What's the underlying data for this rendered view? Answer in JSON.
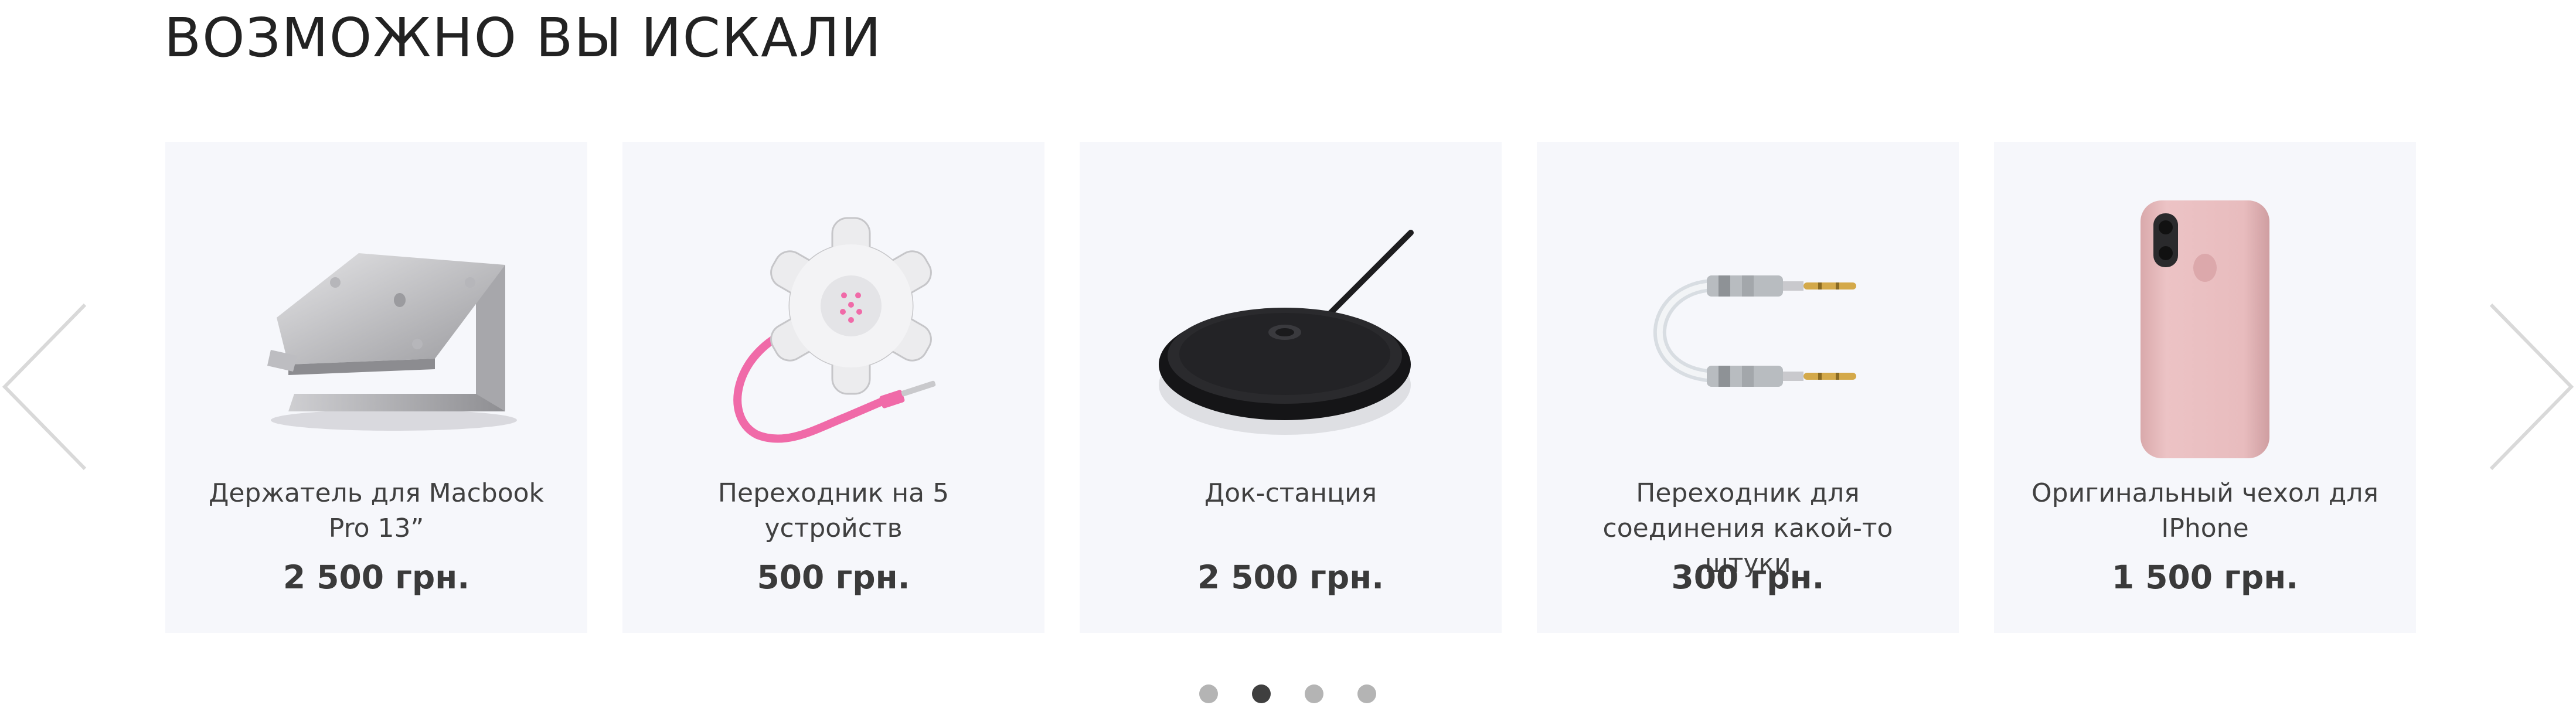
{
  "section": {
    "title": "ВОЗМОЖНО ВЫ ИСКАЛИ"
  },
  "products": [
    {
      "name": "Держатель для Macbook Pro 13”",
      "price": "2 500 грн.",
      "icon": "laptop-stand-image"
    },
    {
      "name": "Переходник на 5 устройств",
      "price": "500 грн.",
      "icon": "audio-splitter-image"
    },
    {
      "name": "Док-станция",
      "price": "2 500 грн.",
      "icon": "wireless-charger-image"
    },
    {
      "name": "Переходник для соединения какой-то штуки",
      "price": "300 грн.",
      "icon": "aux-cable-image"
    },
    {
      "name": "Оригинальный чехол для IPhone",
      "price": "1 500 грн.",
      "icon": "iphone-case-image"
    }
  ],
  "pagination": {
    "count": 4,
    "active_index": 1
  },
  "colors": {
    "card_background": "#f6f7fb",
    "arrow": "#d9d9d9",
    "dot_inactive": "#b4b4b4",
    "dot_active": "#3f3f3f",
    "case_pink": "#e8bcbe",
    "cable_pink": "#f06aa8"
  }
}
